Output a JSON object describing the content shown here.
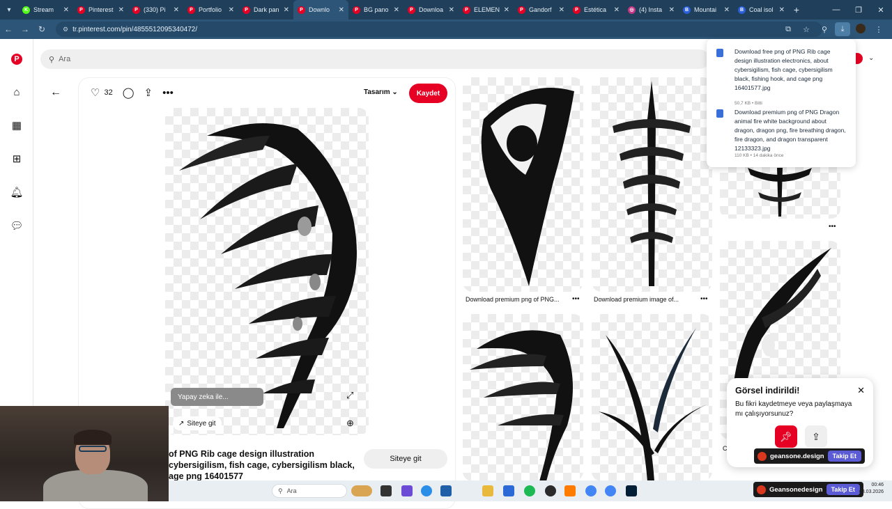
{
  "tabs": [
    {
      "label": "Stream",
      "color": "#53fc18",
      "glyph": "K"
    },
    {
      "label": "Pinterest",
      "color": "#e60023",
      "glyph": "P"
    },
    {
      "label": "(330) Pi",
      "color": "#e60023",
      "glyph": "P"
    },
    {
      "label": "Portfolio",
      "color": "#e60023",
      "glyph": "P"
    },
    {
      "label": "Dark pan",
      "color": "#e60023",
      "glyph": "P"
    },
    {
      "label": "Downlo",
      "color": "#e60023",
      "glyph": "P",
      "active": true
    },
    {
      "label": "BG pano",
      "color": "#e60023",
      "glyph": "P"
    },
    {
      "label": "Downloa",
      "color": "#e60023",
      "glyph": "P"
    },
    {
      "label": "ELEMEN",
      "color": "#e60023",
      "glyph": "P"
    },
    {
      "label": "Gandorf",
      "color": "#e60023",
      "glyph": "P"
    },
    {
      "label": "Estética",
      "color": "#e60023",
      "glyph": "P"
    },
    {
      "label": "(4) Insta",
      "color": "#c13584",
      "glyph": "◎"
    },
    {
      "label": "Mountai",
      "color": "#2b5fd9",
      "glyph": "B"
    },
    {
      "label": "Coal isol",
      "color": "#2b5fd9",
      "glyph": "B"
    }
  ],
  "address": {
    "url": "tr.pinterest.com/pin/4855512095340472/"
  },
  "search": {
    "placeholder": "Ara"
  },
  "pin": {
    "like_count": "32",
    "board_label": "Tasarım",
    "save_label": "Kaydet",
    "ai_label": "Yapay zeka ile...",
    "visit_label": "Siteye git",
    "visit_button": "Siteye git",
    "title": "of PNG Rib cage design illustration cybersigilism, fish cage, cybersigilism black, age png 16401577"
  },
  "grid": {
    "cap1": "Download premium png of PNG...",
    "cap2": "Download premium image of...",
    "cap3": "C"
  },
  "downloads": [
    {
      "name": "Download free png of PNG Rib cage design illustration electronics, about cybersigilism, fish cage, cybersigilism black, fishing hook, and cage png 16401577.jpg",
      "meta": "50,7 KB • Bitti"
    },
    {
      "name": "Download premium png of PNG Dragon animal fire white background about dragon, dragon png, fire breathing dragon, fire dragon, and dragon transparent 12133323.jpg",
      "meta": "110 KB • 14 dakika önce"
    }
  ],
  "toast": {
    "title": "Görsel indirildi!",
    "body": "Bu fikri kaydetmeye veya paylaşmaya mı çalışıyorsunuz?"
  },
  "brand": {
    "name_small": "geansone.design",
    "name_large": "Geansonedesign",
    "follow": "Takip Et"
  },
  "taskbar": {
    "search_placeholder": "Ara",
    "time": "00:46",
    "date": "03.03.2026"
  },
  "colors": {
    "pinterest_red": "#e60023",
    "chrome_dark": "#1f3f5a",
    "chrome_mid": "#2d5577"
  }
}
